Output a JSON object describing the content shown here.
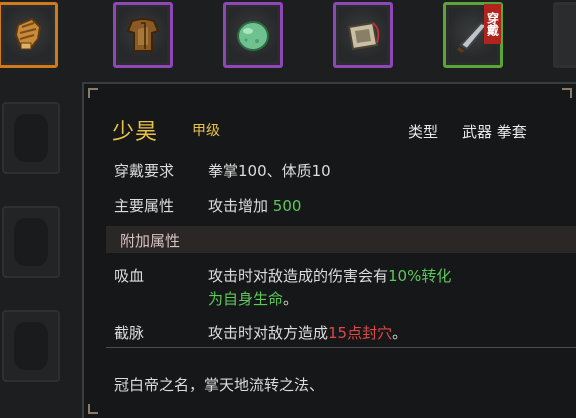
{
  "inventory": {
    "equip_badge": "穿戴",
    "items": [
      {
        "name": "fist-gauntlet-icon",
        "rarity_color": "#d07a1c"
      },
      {
        "name": "leather-armor-icon",
        "rarity_color": "#8f47b8"
      },
      {
        "name": "jade-stone-icon",
        "rarity_color": "#8f47b8"
      },
      {
        "name": "pouch-icon",
        "rarity_color": "#8f47b8"
      },
      {
        "name": "blade-icon",
        "rarity_color": "#59a535"
      }
    ]
  },
  "tooltip": {
    "name": "少昊",
    "grade": "甲级",
    "type_label": "类型",
    "type_value": "武器 拳套",
    "requirement_label": "穿戴要求",
    "requirement_value": "拳掌100、体质10",
    "main_attr_label": "主要属性",
    "main_attr_text": "攻击增加",
    "main_attr_value": "500",
    "extra_section_title": "附加属性",
    "lifesteal_label": "吸血",
    "lifesteal_text_1": "攻击时对敌造成的伤害会有",
    "lifesteal_highlight_1": "10%转化为自身",
    "lifesteal_highlight_2": "生命",
    "lifesteal_end": "。",
    "meridian_label": "截脉",
    "meridian_text": "攻击时对敌方造成",
    "meridian_highlight": "15点封穴",
    "meridian_end": "。",
    "flavor_text": "冠白帝之名，掌天地流转之法、"
  }
}
